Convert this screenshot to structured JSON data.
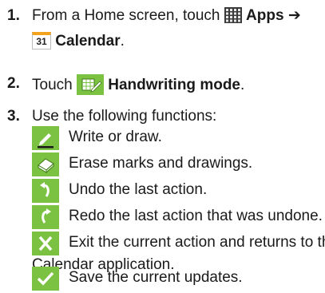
{
  "steps": [
    {
      "number": "1.",
      "text_before": "From a Home screen, touch",
      "apps_icon": "apps-grid-icon",
      "apps_label": "Apps",
      "arrow": "➔",
      "calendar_icon": "calendar-icon",
      "calendar_badge": "31",
      "calendar_label": "Calendar",
      "end": "."
    },
    {
      "number": "2.",
      "text_before": "Touch",
      "mode_icon": "handwriting-mode-icon",
      "mode_label": "Handwriting mode",
      "end": "."
    },
    {
      "number": "3.",
      "text": "Use the following functions:"
    }
  ],
  "functions": [
    {
      "icon": "pen-icon",
      "text": "Write or draw."
    },
    {
      "icon": "eraser-icon",
      "text": "Erase marks and drawings."
    },
    {
      "icon": "undo-icon",
      "text": "Undo the last action."
    },
    {
      "icon": "redo-icon",
      "text": "Redo the last action that was undone."
    },
    {
      "icon": "close-icon",
      "text": "Exit the current action and returns to the",
      "text_line2": "Calendar application."
    },
    {
      "icon": "checkmark-icon",
      "text": "Save the current updates."
    }
  ],
  "colors": {
    "icon_green": "#7cc242",
    "icon_dark_green": "#4e9a1e",
    "calendar_orange": "#f2a21c"
  }
}
